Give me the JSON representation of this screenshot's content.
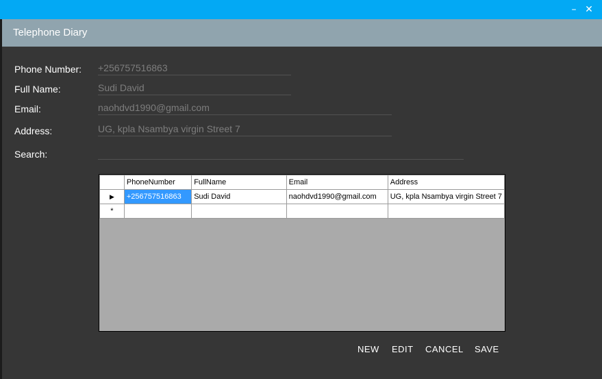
{
  "window": {
    "title": "Telephone Diary",
    "minimize_glyph": "–",
    "close_glyph": "✕"
  },
  "form": {
    "phone": {
      "label": "Phone Number:",
      "value": "+256757516863"
    },
    "fullname": {
      "label": "Full Name:",
      "value": "Sudi David"
    },
    "email": {
      "label": "Email:",
      "value": "naohdvd1990@gmail.com"
    },
    "address": {
      "label": "Address:",
      "value": "UG, kpla Nsambya virgin Street 7"
    },
    "search": {
      "label": "Search:",
      "value": ""
    }
  },
  "grid": {
    "columns": [
      "PhoneNumber",
      "FullName",
      "Email",
      "Address"
    ],
    "rows": [
      {
        "marker": "▶",
        "cells": [
          "+256757516863",
          "Sudi David",
          "naohdvd1990@gmail.com",
          "UG, kpla Nsambya virgin Street 7"
        ]
      }
    ],
    "new_row_marker": "*"
  },
  "actions": {
    "new": "NEW",
    "edit": "EDIT",
    "cancel": "CANCEL",
    "save": "SAVE"
  },
  "colors": {
    "titlebar": "#03a9f4",
    "header": "#90a4ae",
    "background": "#363636",
    "selection": "#3399ff"
  }
}
